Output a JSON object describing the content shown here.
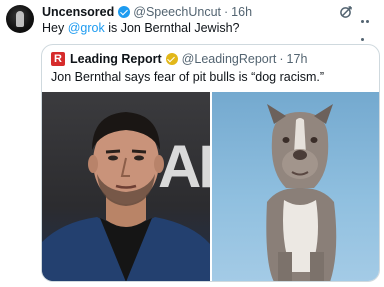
{
  "tweet": {
    "display_name": "Uncensored",
    "handle": "@SpeechUncut",
    "separator": "·",
    "time": "16h",
    "text_before": "Hey ",
    "mention": "@grok",
    "text_after": " is Jon Bernthal Jewish?"
  },
  "quote": {
    "logo_letter": "R",
    "display_name": "Leading Report",
    "handle": "@LeadingReport",
    "separator": "·",
    "time": "17h",
    "text": "Jon Bernthal says fear of pit bulls is “dog racism.”",
    "images": [
      {
        "icon": "portrait-photo",
        "background_letters": "AF"
      },
      {
        "icon": "pit-bull-photo"
      }
    ]
  },
  "icons": {
    "verified": "verified-badge-icon",
    "gold_verified": "gold-verified-badge-icon",
    "grok": "grok-icon",
    "more": "more-icon"
  },
  "colors": {
    "link": "#1d9bf0",
    "secondary_text": "#536471",
    "verified_blue": "#1d9bf0",
    "verified_gold": "#e2b719",
    "logo_red": "#d62b2b"
  }
}
